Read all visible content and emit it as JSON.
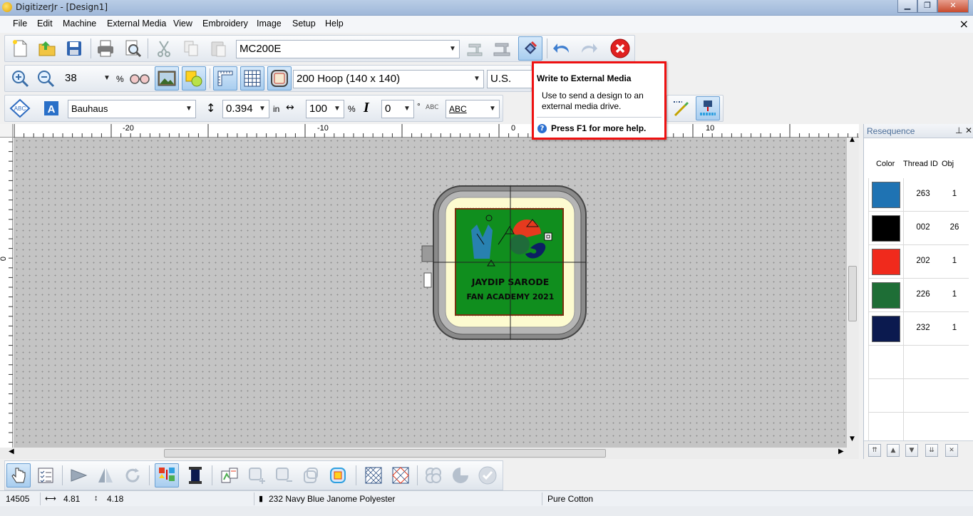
{
  "window": {
    "title": "DigitizerJr - [Design1]"
  },
  "menu": [
    "File",
    "Edit",
    "Machine",
    "External Media",
    "View",
    "Embroidery",
    "Image",
    "Setup",
    "Help"
  ],
  "toolbar1": {
    "machine": "MC200E"
  },
  "toolbar2": {
    "zoom": "38",
    "zoom_unit": "%",
    "hoop": "200 Hoop (140 x 140)",
    "units": "U.S."
  },
  "toolbar3": {
    "font": "Bauhaus",
    "height": "0.394",
    "height_unit": "in",
    "width": "100",
    "width_unit": "%",
    "slant": "0",
    "angle_unit": "°",
    "text_effect": "ABC"
  },
  "tooltip": {
    "title": "Write to External Media",
    "body": "Use to send a design to an external media drive.",
    "help": "Press F1 for more help."
  },
  "ruler": {
    "h_labels": [
      "-20",
      "-10",
      "0",
      "10"
    ],
    "v_label": "0"
  },
  "design": {
    "line1": "JAYDIP SARODE",
    "line2": "FAN ACADEMY 2021"
  },
  "resequence": {
    "title": "Resequence",
    "columns": [
      "Color",
      "Thread ID",
      "Obj"
    ],
    "rows": [
      {
        "color": "#1f73b3",
        "thread_id": "263",
        "obj": "1"
      },
      {
        "color": "#000000",
        "thread_id": "002",
        "obj": "26"
      },
      {
        "color": "#f02a1c",
        "thread_id": "202",
        "obj": "1"
      },
      {
        "color": "#1e6e36",
        "thread_id": "226",
        "obj": "1"
      },
      {
        "color": "#0b1a4f",
        "thread_id": "232",
        "obj": "1"
      }
    ]
  },
  "status": {
    "stitches": "14505",
    "width": "4.81",
    "height": "4.18",
    "thread": "232 Navy Blue Janome Polyester",
    "fabric": "Pure Cotton"
  }
}
